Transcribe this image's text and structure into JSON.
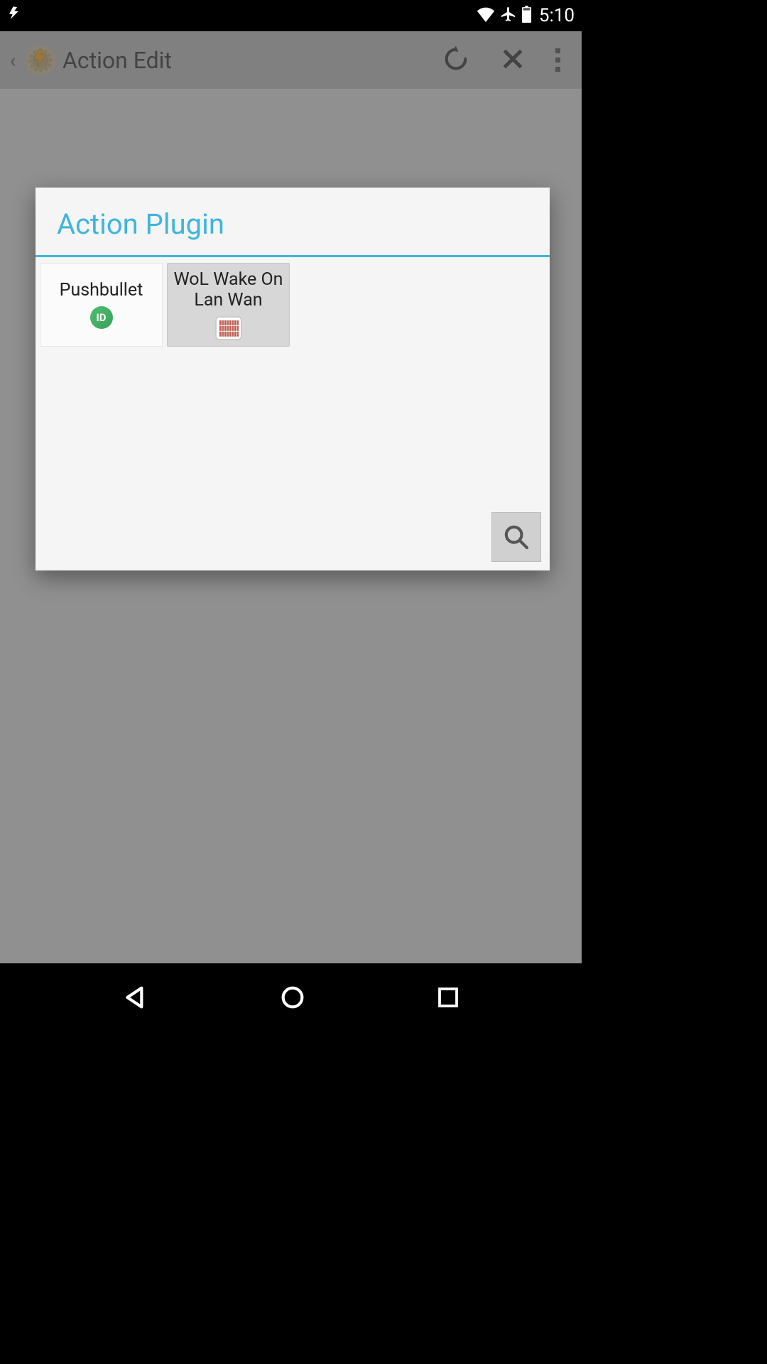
{
  "status": {
    "clock": "5:10"
  },
  "app": {
    "title": "Action Edit"
  },
  "modal": {
    "title": "Action Plugin",
    "plugins": [
      {
        "label": "Pushbullet",
        "icon": "pushbullet-icon"
      },
      {
        "label": "WoL Wake On Lan Wan",
        "icon": "wol-icon"
      }
    ]
  }
}
